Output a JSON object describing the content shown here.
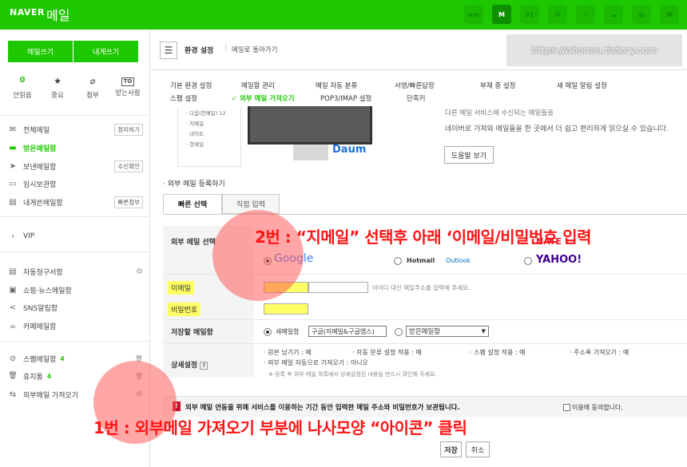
{
  "topbar": {
    "logo": "NAVER",
    "app": "메일",
    "icons": [
      {
        "name": "me-icon",
        "label": "me"
      },
      {
        "name": "mail-icon",
        "label": "M"
      },
      {
        "name": "calendar-icon",
        "label": "31"
      },
      {
        "name": "contacts-icon",
        "label": "≡"
      },
      {
        "name": "phone-icon",
        "label": "✆"
      },
      {
        "name": "cloud-icon",
        "label": "☁"
      },
      {
        "name": "memo-icon",
        "label": "▤"
      },
      {
        "name": "office-icon",
        "label": "W"
      }
    ]
  },
  "sidebar": {
    "write_btn": "메일쓰기",
    "self_btn": "내게쓰기",
    "quick": [
      {
        "top": "0",
        "label": "안읽음",
        "icon": "unread-count"
      },
      {
        "top": "★",
        "label": "중요",
        "icon": "star-icon"
      },
      {
        "top": "⌀",
        "label": "첨부",
        "icon": "attach-icon"
      },
      {
        "top": "TO",
        "label": "받는사람",
        "icon": "to-icon"
      }
    ],
    "menu1": [
      {
        "icon": "✉",
        "label": "전체메일",
        "badge": "정리하기"
      },
      {
        "icon": "▬",
        "label": "받은메일함",
        "badge": ""
      },
      {
        "icon": "➤",
        "label": "보낸메일함",
        "badge": "수신확인"
      },
      {
        "icon": "▭",
        "label": "임시보관함",
        "badge": ""
      },
      {
        "icon": "▤",
        "label": "내게쓴메일함",
        "badge": "빠른첨부"
      }
    ],
    "vip": "VIP",
    "menu2": [
      {
        "icon": "▤",
        "label": "자동청구서함"
      },
      {
        "icon": "▣",
        "label": "쇼핑·뉴스메일함"
      },
      {
        "icon": "<",
        "label": "SNS알림함"
      },
      {
        "icon": "☕",
        "label": "카페메일함"
      }
    ],
    "menu3": [
      {
        "icon": "⊘",
        "label": "스팸메일함",
        "count": "4",
        "action": "🗑"
      },
      {
        "icon": "🗑",
        "label": "휴지통",
        "count": "4",
        "action": "🗑"
      },
      {
        "icon": "⇆",
        "label": "외부메일 가져오기",
        "count": "",
        "action": "⚙"
      }
    ]
  },
  "header": {
    "title": "환경 설정",
    "back": "메일로 돌아가기",
    "watermark": "https://aboneu.tistory.com"
  },
  "settings_tabs": [
    {
      "label": "기본 환경 설정"
    },
    {
      "label": "메일함 관리"
    },
    {
      "label": "메일 자동 분류"
    },
    {
      "label": "서명/빠른답장"
    },
    {
      "label": "부재 중 설정"
    },
    {
      "label": "새 메일 알림 설정"
    },
    {
      "label": "스팸 설정"
    },
    {
      "label": "✓ 외부 메일 가져오기"
    },
    {
      "label": "POP3/IMAP 설정"
    },
    {
      "label": "단축키"
    }
  ],
  "illustration": {
    "list": [
      "다음(한메일) 12",
      "지메일",
      "네이트",
      "한메일"
    ],
    "daum": "Daum"
  },
  "intro": {
    "desc_top": "다른 메일 서비스에 수신되는 메일들을",
    "desc": "네이버로 가져와 메일들을 한 곳에서 더 쉽고 편리하게 읽으실 수 있습니다.",
    "help_btn": "도움말 보기"
  },
  "register": {
    "title": "· 외부 메일 등록하기",
    "tabs": [
      "빠른 선택",
      "직접 입력"
    ],
    "service_label": "외부 메일 선택",
    "services": [
      {
        "name": "Google",
        "selected": true,
        "color": "#4285f4"
      },
      {
        "name": "Hotmail",
        "selected": false,
        "color": "#333333"
      },
      {
        "name": "Outlook",
        "selected": false,
        "color": "#0072c6"
      },
      {
        "name": "YAHOO!",
        "selected": false,
        "color": "#400090"
      },
      {
        "name": "NATE",
        "selected": false,
        "color": "#e8192c"
      }
    ],
    "email_label": "이메일",
    "email_hint": "아이디 대신 메일주소를 입력해 주세요.",
    "password_label": "비밀번호",
    "save_box_label": "저장할 메일함",
    "save_option_new": "새메일함",
    "save_new_value": "구글(지메일&구글앱스)",
    "save_existing_value": "받은메일함",
    "detail_label": "상세설정",
    "details_line1a": "· 원본 남기기 : 예",
    "details_line1b": "· 자동 분류 설정 적용 : 예",
    "details_line1c": "· 스팸 설정 적용 : 예",
    "details_line1d": "· 주소록 가져오기 : 예",
    "details_line2": "· 외부 메일 자동으로 가져오기 : 아니오",
    "details_note": "※ 등록 후 외부 메일 목록에서 상세설정된 내용을 반드시 확인해 주세요."
  },
  "notice": {
    "text": "외부 메일 연동을 위해 서비스를 이용하는 기간 동안 입력한 메일 주소와 비밀번호가 보관됩니다.",
    "agree": "이용에 동의합니다."
  },
  "buttons": {
    "save": "저장",
    "cancel": "취소"
  },
  "annotations": {
    "step2": "2번 : “지메일” 선택후 아래 ‘이메일/비밀번호 입력",
    "step1": "1번 : 외부메일 가져오기 부분에 나사모양 “아이콘” 클릭",
    "color": "#ff1414"
  }
}
